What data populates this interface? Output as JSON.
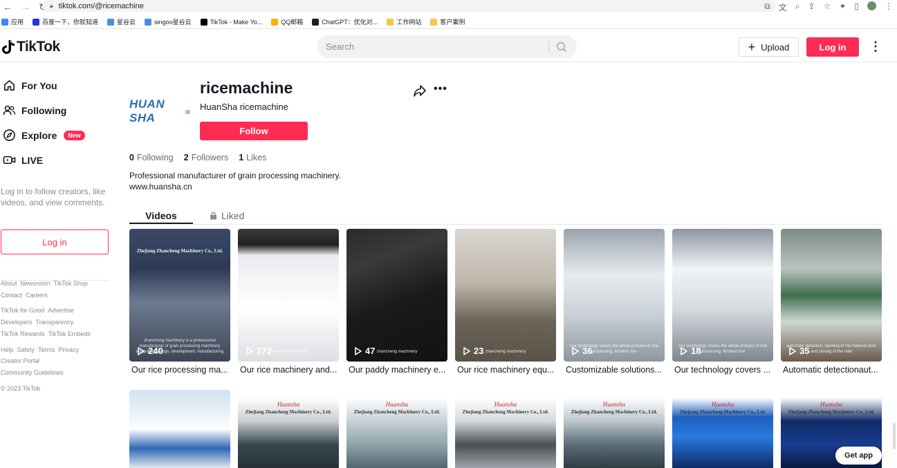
{
  "browser": {
    "url": "tiktok.com/@ricemachine",
    "bookmarks": [
      {
        "label": "应用",
        "color": "#4285f4"
      },
      {
        "label": "百度一下，你就知道",
        "color": "#2932e1"
      },
      {
        "label": "星谷云",
        "color": "#4a90d9"
      },
      {
        "label": "singoo星谷云",
        "color": "#4a90d9"
      },
      {
        "label": "TikTok - Make Yo...",
        "color": "#000000"
      },
      {
        "label": "QQ邮箱",
        "color": "#f4b400"
      },
      {
        "label": "ChatGPT：优化对...",
        "color": "#202123"
      },
      {
        "label": "工作网站",
        "color": "#f6c744"
      },
      {
        "label": "客户案例",
        "color": "#f6c744"
      }
    ]
  },
  "header": {
    "logo": "TikTok",
    "search_placeholder": "Search",
    "upload_label": "Upload",
    "login_label": "Log in"
  },
  "sidebar": {
    "items": [
      {
        "label": "For You",
        "icon": "home-icon"
      },
      {
        "label": "Following",
        "icon": "following-icon"
      },
      {
        "label": "Explore",
        "icon": "compass-icon",
        "badge": "New"
      },
      {
        "label": "LIVE",
        "icon": "live-icon"
      }
    ],
    "prompt": "Log in to follow creators, like videos, and view comments.",
    "login_label": "Log in",
    "footer_rows": [
      [
        "About",
        "Newsroom",
        "TikTok Shop"
      ],
      [
        "Contact",
        "Careers"
      ],
      [
        "TikTok for Good",
        "Advertise"
      ],
      [
        "Developers",
        "Transparency"
      ],
      [
        "TikTok Rewards",
        "TikTok Embeds"
      ],
      [
        "Help",
        "Safety",
        "Terms",
        "Privacy"
      ],
      [
        "Creator Portal"
      ],
      [
        "Community Guidelines"
      ],
      [
        "© 2023 TikTok"
      ]
    ]
  },
  "profile": {
    "avatar_text": "HUAN SHA",
    "username": "ricemachine",
    "nickname": "HuanSha ricemachine",
    "follow_label": "Follow",
    "stats": [
      {
        "num": "0",
        "label": "Following"
      },
      {
        "num": "2",
        "label": "Followers"
      },
      {
        "num": "1",
        "label": "Likes"
      }
    ],
    "bio_line1": "Professional manufacturer of grain processing machinery.",
    "bio_line2": "www.huansha.cn"
  },
  "tabs": {
    "videos": "Videos",
    "liked": "Liked"
  },
  "videos_row1": [
    {
      "views": "240",
      "title": "Our rice processing ma...",
      "overlay": "Zhejiang Zhancheng Machinery Co., Ltd.",
      "caption": "zhancheng machinery is a professional manufacturer of grain processing machinery integrating design, development, manufacturing",
      "bg": "linear-gradient(180deg,#3a4a66 0%,#2c3a55 30%,#6c7b8f 55%,#3d4656 100%)"
    },
    {
      "views": "272",
      "title": "Our rice machinery and...",
      "overlay": "",
      "caption": "zhancheng machinery",
      "bg": "linear-gradient(180deg,#3b3b3b 0%,#1f1f1f 12%,#e9ecef 20%,#ffffff 60%,#dcdfe3 100%)"
    },
    {
      "views": "47",
      "title": "Our paddy machinery e...",
      "overlay": "",
      "caption": "zhancheng machinery",
      "bg": "linear-gradient(160deg,#2b2b2b 0%,#3a3a3a 25%,#1a1a1a 55%,#121212 100%)"
    },
    {
      "views": "23",
      "title": "Our rice machinery equ...",
      "overlay": "",
      "caption": "zhancheng machinery",
      "bg": "linear-gradient(180deg,#d9d6d0 0%,#bfb8ad 40%,#6b6358 70%,#5a5348 100%)"
    },
    {
      "views": "36",
      "title": "Customizable solutions...",
      "overlay": "",
      "caption": "Our technology covers the whole process of rice processing, finished rice",
      "bg": "linear-gradient(180deg,#9aa3ad 0%,#e8ecef 35%,#c9d0d6 65%,#8e979f 100%)"
    },
    {
      "views": "18",
      "title": "Our technology covers ...",
      "overlay": "",
      "caption": "Our technology covers the whole process of rice processing, finished rice",
      "bg": "linear-gradient(180deg,#8c96a1 0%,#f1f3f5 30%,#d7dce1 60%,#7d858e 100%)"
    },
    {
      "views": "35",
      "title": "Automatic detectionaut...",
      "overlay": "",
      "caption": "automatic detection, opening of the material door and closing of the rolle",
      "bg": "linear-gradient(180deg,#7d8b86 0%,#b9c4c0 30%,#3f6e4e 50%,#d0d6d3 70%,#6b5a4a 100%)"
    }
  ],
  "videos_row2": [
    {
      "overlay": "",
      "bg": "linear-gradient(180deg,#cfe3f3 0%,#e8f1f8 30%,#ffffff 50%,#2e68b4 75%,#dfe6ee 100%)",
      "brand": ""
    },
    {
      "overlay": "Zhejiang Zhancheng Machinery Co., Ltd.",
      "bg": "linear-gradient(180deg,#ffffff 0%,#ffffff 10%,#c9ced3 40%,#37474f 70%,#263238 100%)",
      "brand": "Huansha"
    },
    {
      "overlay": "Zhejiang Zhancheng Machinery Co., Ltd.",
      "bg": "linear-gradient(180deg,#ffffff 0%,#ffffff 10%,#c7d2d6 40%,#8fa4ab 70%,#51666d 100%)",
      "brand": "Huansha"
    },
    {
      "overlay": "Zhejiang Zhancheng Machinery Co., Ltd.",
      "bg": "linear-gradient(180deg,#ffffff 0%,#ffffff 10%,#d6dadd 40%,#4a4f54 70%,#9ea4a9 100%)",
      "brand": "Huansha"
    },
    {
      "overlay": "Zhejiang Zhancheng Machinery Co., Ltd.",
      "bg": "linear-gradient(180deg,#ffffff 0%,#ffffff 10%,#bcc6cc 40%,#5b6e78 70%,#2f3d45 100%)",
      "brand": "Huansha"
    },
    {
      "overlay": "Zhejiang Zhancheng Machinery Co., Ltd.",
      "bg": "linear-gradient(180deg,#ffffff 0%,#ffffff 10%,#1e5fbf 35%,#2a7ae0 60%,#0d2c66 100%)",
      "brand": "Huansha"
    },
    {
      "overlay": "Zhejiang Zhancheng Machinery Co., Ltd.",
      "bg": "linear-gradient(180deg,#ffffff 0%,#ffffff 10%,#0f2a66 40%,#1a3d8f 70%,#0a1b40 100%)",
      "brand": "Huansha"
    }
  ],
  "get_app": "Get app",
  "colors": {
    "accent": "#fe2c55",
    "text": "#161823",
    "muted": "#8a8b91"
  }
}
